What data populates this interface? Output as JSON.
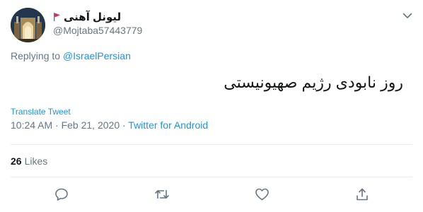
{
  "tweet": {
    "author": {
      "display_name": "لیونل آهنی",
      "handle": "@Mojtaba57443779",
      "flag_icon": "red-flag-icon"
    },
    "reply": {
      "prefix": "Replying to",
      "mention": "@IsraelPersian"
    },
    "text": "روز نابودی رژیم صهیونیستی",
    "translate_label": "Translate Tweet",
    "timestamp": "10:24 AM · Feb 21, 2020 · ",
    "source": "Twitter for Android",
    "likes": {
      "count": "26",
      "label": "Likes"
    },
    "actions": [
      "reply-icon",
      "retweet-icon",
      "like-icon",
      "share-icon"
    ]
  },
  "colors": {
    "link": "#1b95e0",
    "secondary_text": "#657786",
    "primary_text": "#14171a",
    "divider": "#e6ecf0",
    "flag": "#e0245e"
  }
}
